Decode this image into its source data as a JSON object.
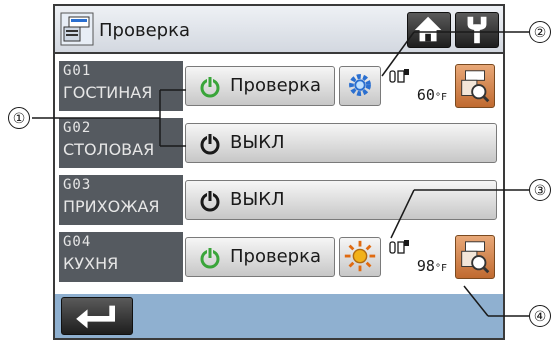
{
  "title": "Проверка",
  "zones": [
    {
      "code": "G01",
      "name": "ГОСТИНАЯ",
      "status": "Проверка",
      "power": "on",
      "mode": "gear-icon",
      "sensor": true,
      "temp": "60",
      "unit": "°F",
      "detail": true
    },
    {
      "code": "G02",
      "name": "СТОЛОВАЯ",
      "status": "ВЫКЛ",
      "power": "off"
    },
    {
      "code": "G03",
      "name": "ПРИХОЖАЯ",
      "status": "ВЫКЛ",
      "power": "off"
    },
    {
      "code": "G04",
      "name": "КУХНЯ",
      "status": "Проверка",
      "power": "on",
      "mode": "sun-icon",
      "sensor": true,
      "temp": "98",
      "unit": "°F",
      "detail": true
    }
  ],
  "callouts": [
    "①",
    "②",
    "③",
    "④"
  ],
  "colors": {
    "power_on": "#3aa53a",
    "power_off": "#1a1a1a",
    "detail_btn": "#c06a30",
    "footer": "#8fb0d0"
  }
}
